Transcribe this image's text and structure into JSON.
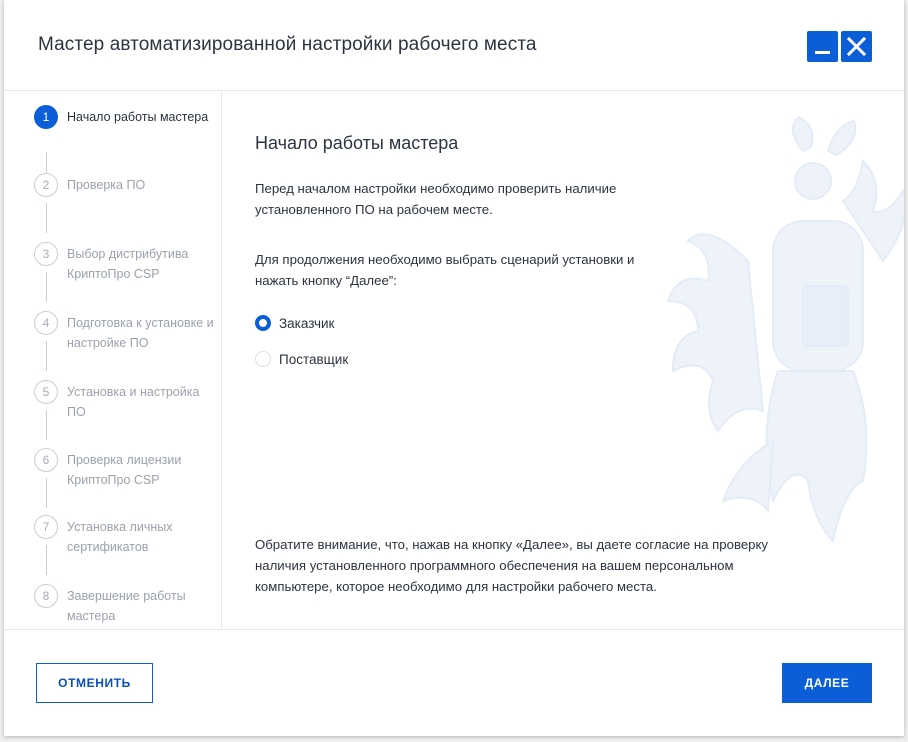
{
  "window": {
    "title": "Мастер автоматизированной настройки рабочего места",
    "minimize_icon": "minimize-icon",
    "close_icon": "close-icon",
    "accent_color": "#0b5ed7"
  },
  "steps": [
    {
      "number": "1",
      "label": "Начало работы мастера",
      "active": true
    },
    {
      "number": "2",
      "label": "Проверка ПО",
      "active": false
    },
    {
      "number": "3",
      "label": "Выбор дистрибутива КриптоПро CSP",
      "active": false
    },
    {
      "number": "4",
      "label": "Подготовка к установке и настройке ПО",
      "active": false
    },
    {
      "number": "5",
      "label": "Установка и настройка ПО",
      "active": false
    },
    {
      "number": "6",
      "label": "Проверка лицензии КриптоПро CSP",
      "active": false
    },
    {
      "number": "7",
      "label": "Установка личных сертификатов",
      "active": false
    },
    {
      "number": "8",
      "label": "Завершение работы мастера",
      "active": false
    }
  ],
  "main": {
    "heading": "Начало работы мастера",
    "intro": "Перед началом настройки  необходимо проверить наличие установленного ПО на рабочем месте.",
    "instruction": "Для продолжения необходимо выбрать сценарий установки и нажать кнопку “Далее”:",
    "options": [
      {
        "label": "Заказчик",
        "selected": true
      },
      {
        "label": "Поставщик",
        "selected": false
      }
    ],
    "notice": "Обратите внимание, что, нажав на кнопку «Далее», вы даете согласие на проверку наличия установленного программного обеспечения на вашем персональном компьютере, которое необходимо для настройки рабочего места."
  },
  "footer": {
    "cancel_label": "ОТМЕНИТЬ",
    "next_label": "ДАЛЕЕ"
  }
}
